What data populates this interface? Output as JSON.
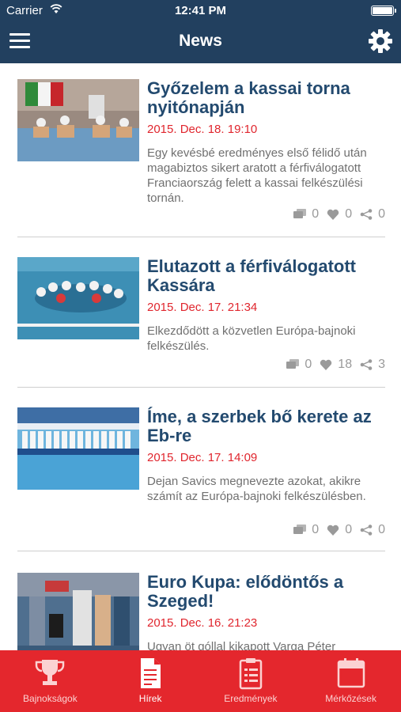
{
  "status_bar": {
    "carrier": "Carrier",
    "time": "12:41 PM"
  },
  "nav": {
    "title": "News",
    "menu_icon": "hamburger-icon",
    "settings_icon": "gear-icon"
  },
  "articles": [
    {
      "title": "Győzelem a kassai torna nyitónapján",
      "date": "2015. Dec. 18. 19:10",
      "description": "Egy kevésbé eredményes első félidő után magabiztos sikert aratott a férfiválogatott Franciaország felett a kassai felkészülési tornán.",
      "comments": "0",
      "likes": "0",
      "shares": "0"
    },
    {
      "title": "Elutazott a férfiválogatott Kassára",
      "date": "2015. Dec. 17. 21:34",
      "description": "Elkezdődött a közvetlen Európa-bajnoki felkészülés.",
      "comments": "0",
      "likes": "18",
      "shares": "3"
    },
    {
      "title": "Íme, a szerbek bő kerete az Eb-re",
      "date": "2015. Dec. 17. 14:09",
      "description": "Dejan Savics megnevezte azokat, akikre számít az Európa-bajnoki felkészülésben.",
      "comments": "0",
      "likes": "0",
      "shares": "0"
    },
    {
      "title": "Euro Kupa: elődöntős a Szeged!",
      "date": "2015. Dec. 16. 21:23",
      "description": "Ugyan öt góllal kikapott Varga Péter",
      "comments": "",
      "likes": "",
      "shares": ""
    }
  ],
  "tabs": [
    {
      "label": "Bajnokságok",
      "icon": "trophy-icon"
    },
    {
      "label": "Hírek",
      "icon": "document-icon"
    },
    {
      "label": "Eredmények",
      "icon": "clipboard-icon"
    },
    {
      "label": "Mérkőzések",
      "icon": "calendar-icon"
    }
  ],
  "colors": {
    "header": "#22405f",
    "tabbar": "#e4272d",
    "title": "#234a6f",
    "date": "#e0262e"
  }
}
